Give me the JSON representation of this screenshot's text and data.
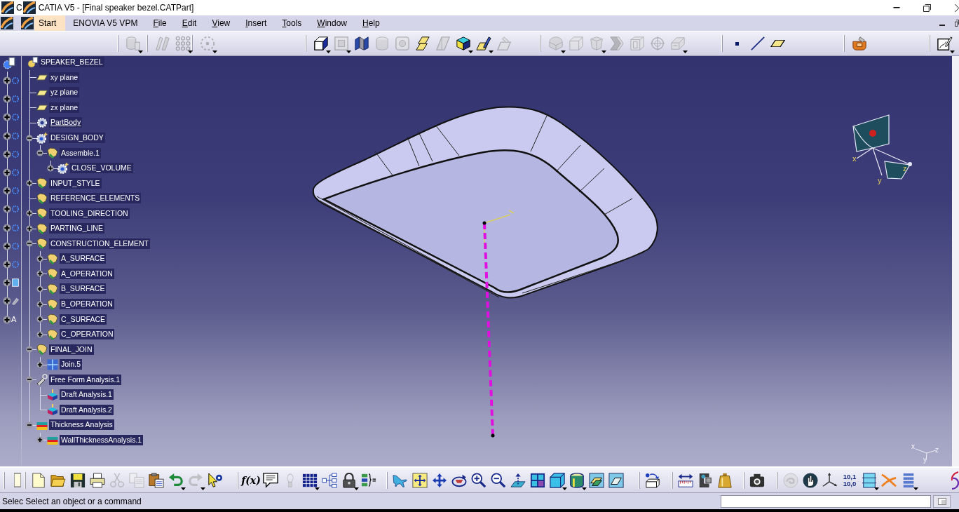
{
  "title_bar": {
    "prefix": "C",
    "title": "CATIA V5 - [Final speaker bezel.CATPart]"
  },
  "menu_bar": {
    "items": [
      {
        "label": "Start",
        "highlighted": true,
        "mnemonic": false
      },
      {
        "label": "ENOVIA V5 VPM",
        "highlighted": false,
        "mnemonic": false
      },
      {
        "label": "File",
        "highlighted": false,
        "mnemonic": true
      },
      {
        "label": "Edit",
        "highlighted": false,
        "mnemonic": true
      },
      {
        "label": "View",
        "highlighted": false,
        "mnemonic": true
      },
      {
        "label": "Insert",
        "highlighted": false,
        "mnemonic": true
      },
      {
        "label": "Tools",
        "highlighted": false,
        "mnemonic": true
      },
      {
        "label": "Window",
        "highlighted": false,
        "mnemonic": true
      },
      {
        "label": "Help",
        "highlighted": false,
        "mnemonic": true
      }
    ]
  },
  "top_toolbar": {
    "groups": [
      {
        "items": [
          {
            "kind": "cylinders",
            "disabled": true,
            "dropdown": true
          }
        ]
      },
      {
        "items": [
          {
            "kind": "ribs",
            "disabled": true,
            "dropdown": false
          },
          {
            "kind": "dotgrid",
            "disabled": true,
            "dropdown": true
          }
        ]
      },
      {
        "items": [
          {
            "kind": "pointcloud",
            "disabled": true,
            "dropdown": true
          }
        ]
      },
      {
        "items": [
          {
            "kind": "extrude",
            "disabled": false,
            "dropdown": true
          },
          {
            "kind": "frame",
            "disabled": true,
            "dropdown": true
          },
          {
            "kind": "split",
            "disabled": false,
            "dropdown": false
          },
          {
            "kind": "cylinder",
            "disabled": true,
            "dropdown": false
          },
          {
            "kind": "roundframe",
            "disabled": true,
            "dropdown": false
          },
          {
            "kind": "plates",
            "disabled": false,
            "dropdown": false
          },
          {
            "kind": "wedge",
            "disabled": true,
            "dropdown": false
          },
          {
            "kind": "cube",
            "disabled": false,
            "dropdown": true
          },
          {
            "kind": "pencilsurf",
            "disabled": false,
            "dropdown": true
          },
          {
            "kind": "surfsketch",
            "disabled": true,
            "dropdown": false
          }
        ]
      },
      {
        "items": [
          {
            "kind": "roundblock",
            "disabled": true,
            "dropdown": true
          },
          {
            "kind": "chamfer",
            "disabled": true,
            "dropdown": false
          },
          {
            "kind": "draft",
            "disabled": true,
            "dropdown": true
          },
          {
            "kind": "chevron",
            "disabled": true,
            "dropdown": false
          },
          {
            "kind": "layered",
            "disabled": true,
            "dropdown": false
          },
          {
            "kind": "crosshair",
            "disabled": true,
            "dropdown": false
          },
          {
            "kind": "slotbox",
            "disabled": true,
            "dropdown": true
          }
        ]
      },
      {
        "items": [
          {
            "kind": "point",
            "disabled": false,
            "dropdown": false
          },
          {
            "kind": "line",
            "disabled": false,
            "dropdown": false
          },
          {
            "kind": "plane",
            "disabled": false,
            "dropdown": false
          }
        ]
      },
      {
        "items": [
          {
            "kind": "sketchtool",
            "disabled": false,
            "dropdown": false
          }
        ]
      },
      {
        "items": [
          {
            "kind": "sketch",
            "disabled": false,
            "dropdown": true
          }
        ]
      }
    ]
  },
  "side_tree": {
    "nodes": [
      {
        "kind": "part"
      },
      {
        "kind": "gear",
        "expanded": false
      },
      {
        "kind": "gear",
        "expanded": false
      },
      {
        "kind": "gear",
        "expanded": false
      },
      {
        "kind": "gear",
        "expanded": false
      },
      {
        "kind": "gear",
        "expanded": false
      },
      {
        "kind": "gear",
        "expanded": false
      },
      {
        "kind": "gear",
        "expanded": false
      },
      {
        "kind": "gear",
        "expanded": false
      },
      {
        "kind": "gear",
        "expanded": false
      },
      {
        "kind": "gear",
        "expanded": false
      },
      {
        "kind": "gear",
        "expanded": false
      },
      {
        "kind": "doc",
        "expanded": false
      },
      {
        "kind": "tool",
        "expanded": false
      },
      {
        "kind": "label",
        "label": "A",
        "expanded": false
      }
    ]
  },
  "tree": {
    "label": "SPEAKER_BEZEL",
    "kind": "part",
    "current": false,
    "children": [
      {
        "label": "xy plane",
        "kind": "plane",
        "current": false
      },
      {
        "label": "yz plane",
        "kind": "plane",
        "current": false
      },
      {
        "label": "zx plane",
        "kind": "plane",
        "current": false
      },
      {
        "label": "PartBody",
        "kind": "body",
        "current": true
      },
      {
        "label": "DESIGN_BODY",
        "kind": "bodynew",
        "expanded": true,
        "current": false,
        "children": [
          {
            "label": "Assemble.1",
            "kind": "geoset",
            "expanded": true,
            "current": false,
            "children": [
              {
                "label": "CLOSE_VOLUME",
                "kind": "bodynew",
                "expanded": false,
                "current": false
              }
            ]
          }
        ]
      },
      {
        "label": "INPUT_STYLE",
        "kind": "geoset",
        "expanded": false,
        "current": false
      },
      {
        "label": "REFERENCE_ELEMENTS",
        "kind": "geoset",
        "current": false
      },
      {
        "label": "TOOLING_DIRECTION",
        "kind": "geoset",
        "expanded": false,
        "current": false
      },
      {
        "label": "PARTING_LINE",
        "kind": "geoset",
        "expanded": false,
        "current": false
      },
      {
        "label": "CONSTRUCTION_ELEMENT",
        "kind": "geoset",
        "expanded": true,
        "current": false,
        "children": [
          {
            "label": "A_SURFACE",
            "kind": "geoset",
            "expanded": false,
            "current": false
          },
          {
            "label": "A_OPERATION",
            "kind": "geoset",
            "expanded": false,
            "current": false
          },
          {
            "label": "B_SURFACE",
            "kind": "geoset",
            "expanded": false,
            "current": false
          },
          {
            "label": "B_OPERATION",
            "kind": "geoset",
            "expanded": false,
            "current": false
          },
          {
            "label": "C_SURFACE",
            "kind": "geoset",
            "expanded": false,
            "current": false
          },
          {
            "label": "C_OPERATION",
            "kind": "geoset",
            "expanded": false,
            "current": false
          }
        ]
      },
      {
        "label": "FINAL_JOIN",
        "kind": "geoset",
        "expanded": true,
        "current": false,
        "children": [
          {
            "label": "Join.5",
            "kind": "join",
            "expanded": false,
            "current": false
          }
        ]
      },
      {
        "label": "Free Form Analysis.1",
        "kind": "probe",
        "expanded": true,
        "current": false,
        "children": [
          {
            "label": "Draft Analysis.1",
            "kind": "draft",
            "current": false
          },
          {
            "label": "Draft Analysis.2",
            "kind": "draft",
            "current": false
          }
        ]
      },
      {
        "label": "Thickness Analysis",
        "kind": "thickness",
        "expanded": true,
        "current": false,
        "children": [
          {
            "label": "WallThicknessAnalysis.1",
            "kind": "thickness",
            "expanded": false,
            "current": false
          }
        ]
      }
    ]
  },
  "viewport": {
    "compass": {
      "labels": [
        "x",
        "y",
        "z"
      ]
    },
    "axis_triad": {
      "labels": [
        "x",
        "y",
        "z"
      ]
    }
  },
  "bottom_toolbar": {
    "groups": [
      {
        "items": [
          {
            "kind": "panel",
            "disabled": false,
            "dropdown": false
          }
        ]
      },
      {
        "items": [
          {
            "kind": "new",
            "disabled": false,
            "dropdown": false
          },
          {
            "kind": "open",
            "disabled": false,
            "dropdown": false
          },
          {
            "kind": "save",
            "disabled": false,
            "dropdown": false
          },
          {
            "kind": "print",
            "disabled": false,
            "dropdown": false
          },
          {
            "kind": "cut",
            "disabled": true,
            "dropdown": false
          },
          {
            "kind": "copy",
            "disabled": true,
            "dropdown": false
          },
          {
            "kind": "paste",
            "disabled": false,
            "dropdown": false
          },
          {
            "kind": "undo",
            "disabled": false,
            "dropdown": true
          },
          {
            "kind": "redo",
            "disabled": true,
            "dropdown": true
          },
          {
            "kind": "help",
            "disabled": false,
            "dropdown": false
          }
        ]
      },
      {
        "items": [
          {
            "kind": "formula",
            "text": "f(x)",
            "disabled": false,
            "dropdown": false
          },
          {
            "kind": "comment",
            "disabled": false,
            "dropdown": false
          },
          {
            "kind": "lamp",
            "disabled": true,
            "dropdown": false
          },
          {
            "kind": "table",
            "disabled": false,
            "dropdown": true
          },
          {
            "kind": "hierarchy",
            "disabled": false,
            "dropdown": false
          },
          {
            "kind": "lock",
            "disabled": false,
            "dropdown": true
          },
          {
            "kind": "listeq",
            "disabled": false,
            "dropdown": false
          }
        ]
      },
      {
        "items": [
          {
            "kind": "fly",
            "disabled": false,
            "dropdown": false
          },
          {
            "kind": "fitall",
            "disabled": false,
            "dropdown": false
          },
          {
            "kind": "pan",
            "disabled": false,
            "dropdown": false
          },
          {
            "kind": "rotate",
            "disabled": false,
            "dropdown": false
          },
          {
            "kind": "zoomin",
            "disabled": false,
            "dropdown": false
          },
          {
            "kind": "zoomout",
            "disabled": false,
            "dropdown": false
          },
          {
            "kind": "normalview",
            "disabled": false,
            "dropdown": false
          },
          {
            "kind": "fourpanes",
            "disabled": false,
            "dropdown": false
          },
          {
            "kind": "cubeview",
            "disabled": false,
            "dropdown": true
          },
          {
            "kind": "shadedcyl",
            "disabled": false,
            "dropdown": true
          },
          {
            "kind": "hideshow",
            "disabled": false,
            "dropdown": false
          },
          {
            "kind": "swap",
            "disabled": false,
            "dropdown": false
          }
        ]
      },
      {
        "items": [
          {
            "kind": "rotbox",
            "disabled": false,
            "dropdown": false
          }
        ]
      },
      {
        "items": [
          {
            "kind": "measure",
            "disabled": false,
            "dropdown": false
          },
          {
            "kind": "measureitem",
            "disabled": false,
            "dropdown": false
          },
          {
            "kind": "weight",
            "disabled": false,
            "dropdown": false
          }
        ]
      },
      {
        "items": [
          {
            "kind": "camera",
            "disabled": false,
            "dropdown": false
          }
        ]
      },
      {
        "items": [
          {
            "kind": "swirl",
            "disabled": true,
            "dropdown": false
          },
          {
            "kind": "handglobe",
            "disabled": false,
            "dropdown": false
          },
          {
            "kind": "axis",
            "disabled": false,
            "dropdown": false
          },
          {
            "kind": "numbers",
            "lines": [
              "10,1",
              "10,0"
            ],
            "disabled": false,
            "dropdown": false
          },
          {
            "kind": "boxview",
            "disabled": false,
            "dropdown": true
          },
          {
            "kind": "crosscurves",
            "disabled": false,
            "dropdown": false
          },
          {
            "kind": "list",
            "disabled": false,
            "dropdown": true
          }
        ]
      }
    ]
  },
  "status_bar": {
    "message": "Selec Select an object or a command"
  }
}
